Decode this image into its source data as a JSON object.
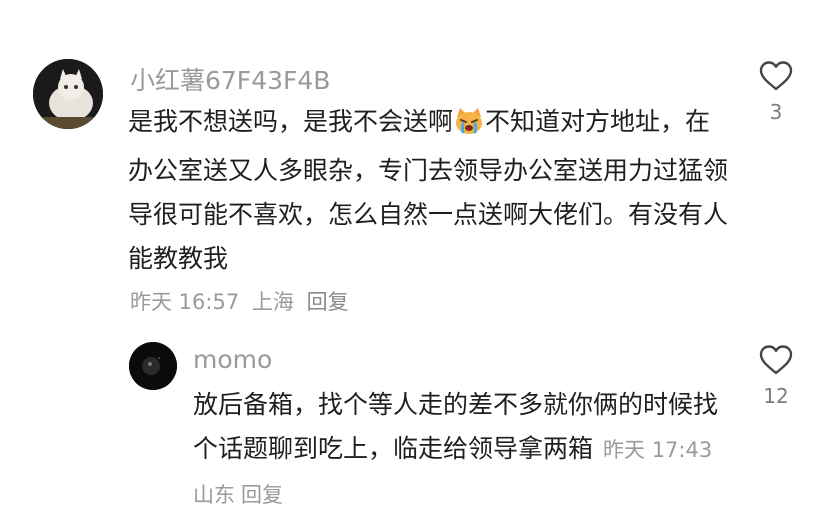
{
  "comments": [
    {
      "username": "小红薯67F43F4B",
      "text_a": "是我不想送吗，是我不会送啊",
      "emoji": "crying-cat-emoji",
      "text_b": "不知道对方地址，在办公室送又人多眼杂，专门去领导办公室送用力过猛领导很可能不喜欢，怎么自然一点送啊大佬们。有没有人能教教我",
      "time": "昨天 16:57",
      "location": "上海",
      "reply_label": "回复",
      "like_count": "3"
    },
    {
      "username": "momo",
      "text": "放后备箱，找个等人走的差不多就你俩的时候找个话题聊到吃上，临走给领导拿两箱",
      "time": "昨天 17:43",
      "location": "山东",
      "reply_label": "回复",
      "like_count": "12"
    }
  ],
  "colors": {
    "text": "#1f1f1f",
    "muted": "#9a9a9a",
    "icon": "#444444"
  }
}
